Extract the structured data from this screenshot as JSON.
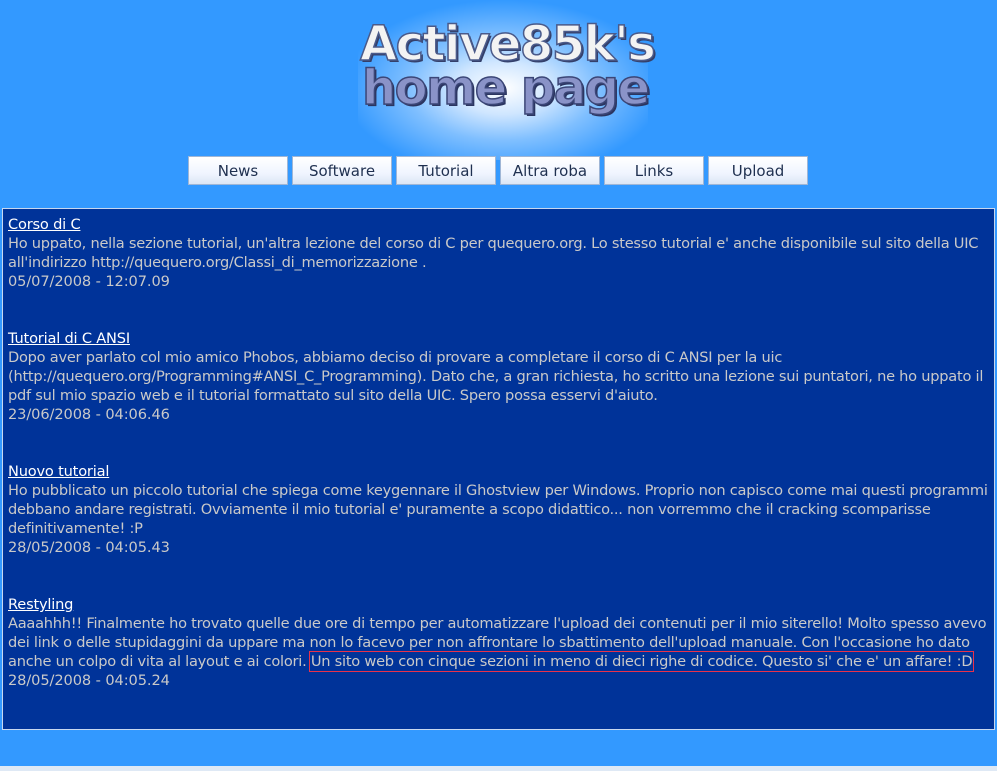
{
  "logo": {
    "line1": "Active85k's",
    "line2": "home page"
  },
  "nav": {
    "items": [
      {
        "label": "News"
      },
      {
        "label": "Software"
      },
      {
        "label": "Tutorial"
      },
      {
        "label": "Altra roba"
      },
      {
        "label": "Links"
      },
      {
        "label": "Upload"
      }
    ]
  },
  "news": [
    {
      "title": "Corso di C",
      "body": "Ho uppato, nella sezione tutorial, un'altra lezione del corso di C per quequero.org. Lo stesso tutorial e' anche disponibile sul sito della UIC all'indirizzo http://quequero.org/Classi_di_memorizzazione .",
      "date": "05/07/2008 - 12:07.09"
    },
    {
      "title": "Tutorial di C ANSI",
      "body": "Dopo aver parlato col mio amico Phobos, abbiamo deciso di provare a completare il corso di C ANSI per la uic (http://quequero.org/Programming#ANSI_C_Programming). Dato che, a gran richiesta, ho scritto una lezione sui puntatori, ne ho uppato il pdf sul mio spazio web e il tutorial formattato sul sito della UIC. Spero possa esservi d'aiuto.",
      "date": "23/06/2008 - 04:06.46"
    },
    {
      "title": "Nuovo tutorial",
      "body": "Ho pubblicato un piccolo tutorial che spiega come keygennare il Ghostview per Windows. Proprio non capisco come mai questi programmi debbano andare registrati. Ovviamente il mio tutorial e' puramente a scopo didattico... non vorremmo che il cracking scomparisse definitivamente! :P",
      "date": "28/05/2008 - 04:05.43"
    },
    {
      "title": "Restyling",
      "body": "Aaaahhh!! Finalmente ho trovato quelle due ore di tempo per automatizzare l'upload dei contenuti per il mio siterello! Molto spesso avevo dei link o delle stupidaggini da uppare ma non lo facevo per non affrontare lo sbattimento dell'upload manuale. Con l'occasione ho dato anche un colpo di vita al layout e ai colori.",
      "body_highlight": "Un sito web con cinque sezioni in meno di dieci righe di codice. Questo si' che e' un affare! :D",
      "date": "28/05/2008 - 04:05.24"
    }
  ],
  "colors": {
    "page_bg": "#3399ff",
    "content_bg": "#003399",
    "text": "#c9c9c9",
    "title": "#ffffff",
    "highlight_border": "#e8324a"
  }
}
